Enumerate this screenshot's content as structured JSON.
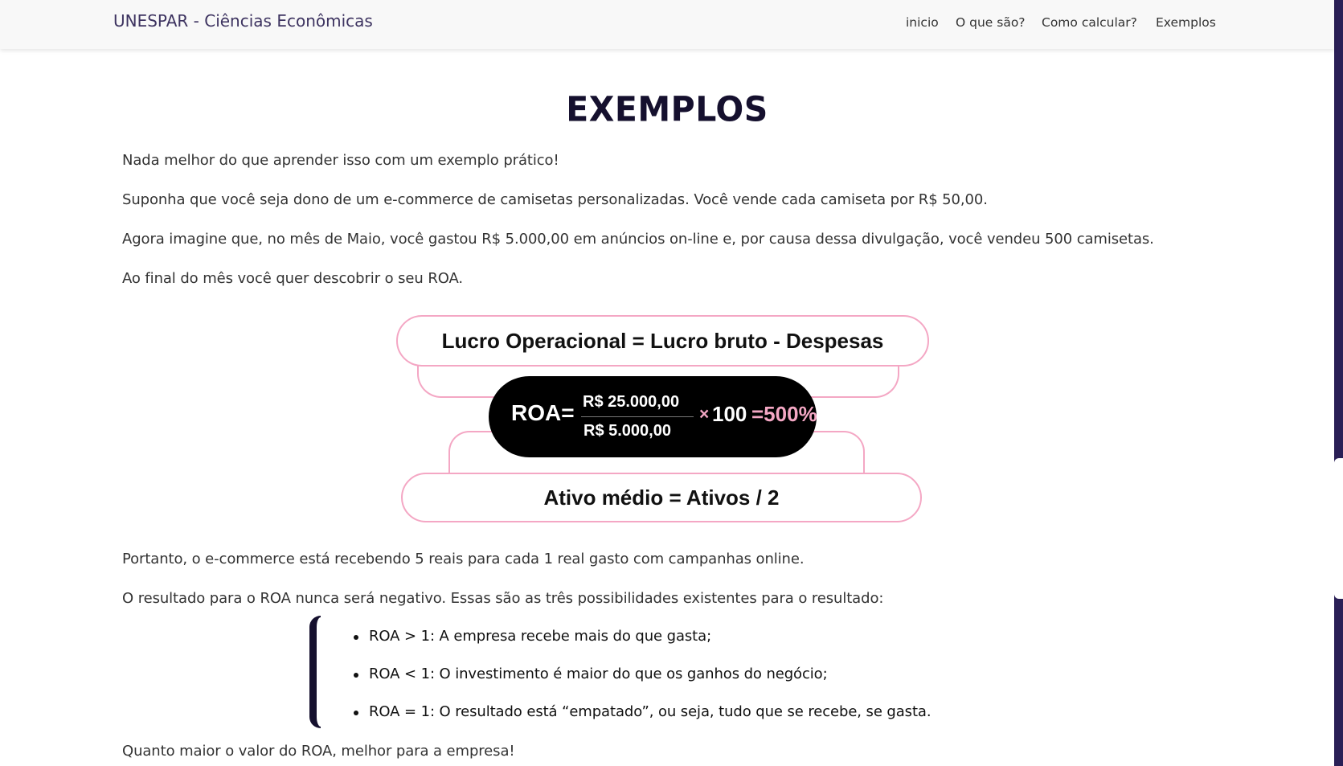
{
  "navbar": {
    "brand_prefix": "UNESPAR - ",
    "brand_suffix": "Ciências Econômicas",
    "links": [
      "inicio",
      "O que são?",
      "Como calcular?",
      "Exemplos"
    ]
  },
  "main": {
    "title": "EXEMPLOS",
    "paragraphs": [
      "Nada melhor do que aprender isso com um exemplo prático!",
      "Suponha que você seja dono de um e-commerce de camisetas personalizadas. Você vende cada camiseta por R$ 50,00.",
      "Agora imagine que, no mês de Maio, você gastou R$ 5.000,00 em anúncios on-line e, por causa dessa divulgação, você vendeu 500 camisetas.",
      "Ao final do mês você quer descobrir o seu ROA."
    ],
    "diagram": {
      "top_formula": "Lucro Operacional = Lucro bruto - Despesas",
      "roa_label": "ROA=",
      "numerator": "R$ 25.000,00",
      "denominator": "R$ 5.000,00",
      "times_sign": "×",
      "multiplier": "100",
      "result": "=500%",
      "bottom_formula": "Ativo médio = Ativos / 2"
    },
    "after_paragraphs": [
      "Portanto, o e-commerce está recebendo 5 reais para cada 1 real gasto com campanhas online.",
      "O resultado para o ROA nunca será negativo. Essas são as três possibilidades existentes para o resultado:"
    ],
    "bullets": [
      "ROA > 1: A empresa recebe mais do que gasta;",
      "ROA < 1: O investimento é maior do que os ganhos do negócio;",
      "ROA = 1: O resultado está “empatado”, ou seja, tudo que se recebe, se gasta."
    ],
    "closing": "Quanto maior o valor do ROA, melhor para a empresa!"
  },
  "colors": {
    "brand_text": "#3d3360",
    "title": "#15102e",
    "accent_pink": "#f4a7c4",
    "sidebar": "#2a1f56"
  }
}
